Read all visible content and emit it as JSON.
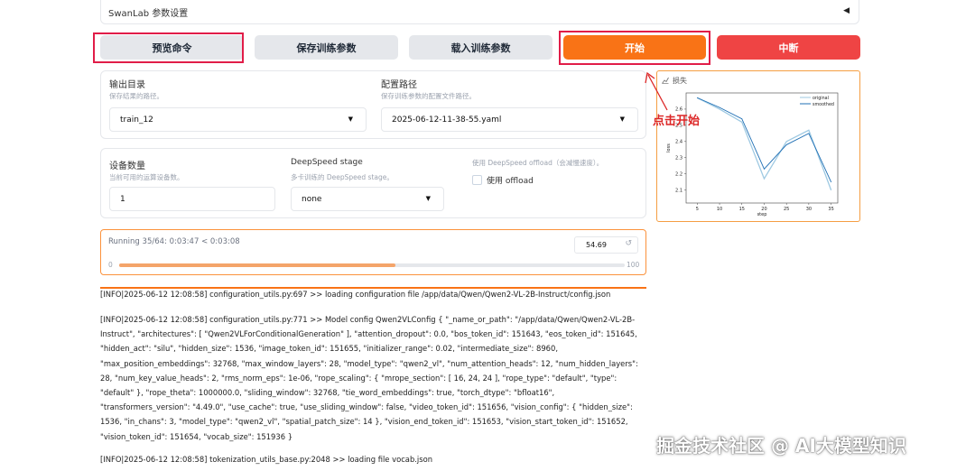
{
  "accordion": {
    "title": "SwanLab 参数设置",
    "caret": "◀"
  },
  "buttons": {
    "preview": "预览命令",
    "save": "保存训练参数",
    "load": "载入训练参数",
    "start": "开始",
    "stop": "中断"
  },
  "output": {
    "label": "输出目录",
    "hint": "保存结果的路径。",
    "value": "train_12"
  },
  "config": {
    "label": "配置路径",
    "hint": "保存训练参数的配置文件路径。",
    "value": "2025-06-12-11-38-55.yaml"
  },
  "devices": {
    "label": "设备数量",
    "hint": "当前可用的运算设备数。",
    "value": "1"
  },
  "deepspeed": {
    "label": "DeepSpeed stage",
    "hint": "多卡训练的 DeepSpeed stage。",
    "value": "none"
  },
  "offload": {
    "hint": "使用 DeepSpeed offload（会减慢速度）。",
    "label": "使用 offload"
  },
  "progress": {
    "status": "Running 35/64: 0:03:47 < 0:03:08",
    "value": "54.69",
    "min": "0",
    "max": "100",
    "fraction": 0.5469,
    "reset_icon": "↺"
  },
  "logs": [
    "[INFO|2025-06-12 12:08:58] configuration_utils.py:697 >> loading configuration file /app/data/Qwen/Qwen2-VL-2B-Instruct/config.json",
    "[INFO|2025-06-12 12:08:58] configuration_utils.py:771 >> Model config Qwen2VLConfig { \"_name_or_path\": \"/app/data/Qwen/Qwen2-VL-2B-Instruct\", \"architectures\": [ \"Qwen2VLForConditionalGeneration\" ], \"attention_dropout\": 0.0, \"bos_token_id\": 151643, \"eos_token_id\": 151645, \"hidden_act\": \"silu\", \"hidden_size\": 1536, \"image_token_id\": 151655, \"initializer_range\": 0.02, \"intermediate_size\": 8960, \"max_position_embeddings\": 32768, \"max_window_layers\": 28, \"model_type\": \"qwen2_vl\", \"num_attention_heads\": 12, \"num_hidden_layers\": 28, \"num_key_value_heads\": 2, \"rms_norm_eps\": 1e-06, \"rope_scaling\": { \"mrope_section\": [ 16, 24, 24 ], \"rope_type\": \"default\", \"type\": \"default\" }, \"rope_theta\": 1000000.0, \"sliding_window\": 32768, \"tie_word_embeddings\": true, \"torch_dtype\": \"bfloat16\", \"transformers_version\": \"4.49.0\", \"use_cache\": true, \"use_sliding_window\": false, \"video_token_id\": 151656, \"vision_config\": { \"hidden_size\": 1536, \"in_chans\": 3, \"model_type\": \"qwen2_vl\", \"spatial_patch_size\": 14 }, \"vision_end_token_id\": 151653, \"vision_start_token_id\": 151652, \"vision_token_id\": 151654, \"vocab_size\": 151936 }",
    "[INFO|2025-06-12 12:08:58] tokenization_utils_base.py:2048 >> loading file vocab.json"
  ],
  "chart": {
    "tab_label": "损失",
    "tab_icon": "chart-icon"
  },
  "chart_data": {
    "type": "line",
    "title": "",
    "xlabel": "step",
    "ylabel": "loss",
    "x": [
      5,
      10,
      15,
      20,
      25,
      30,
      35
    ],
    "xlim": [
      2.5,
      36.5
    ],
    "ylim": [
      2.02,
      2.7
    ],
    "xticks": [
      "5",
      "10",
      "15",
      "20",
      "25",
      "30",
      "35"
    ],
    "yticks": [
      "2.1",
      "2.2",
      "2.3",
      "2.4",
      "2.5",
      "2.6"
    ],
    "ytick_values": [
      2.1,
      2.2,
      2.3,
      2.4,
      2.5,
      2.6
    ],
    "legend": "top-right",
    "series": [
      {
        "name": "original",
        "color": "#9ec9e2",
        "values": [
          2.67,
          2.6,
          2.52,
          2.17,
          2.4,
          2.47,
          2.1
        ]
      },
      {
        "name": "smoothed",
        "color": "#1f6fb4",
        "values": [
          2.67,
          2.61,
          2.54,
          2.23,
          2.38,
          2.45,
          2.15
        ]
      }
    ]
  },
  "annotation": {
    "text": "点击开始",
    "color": "#dc2626"
  },
  "watermark": "掘金技术社区 @ AI大模型知识"
}
